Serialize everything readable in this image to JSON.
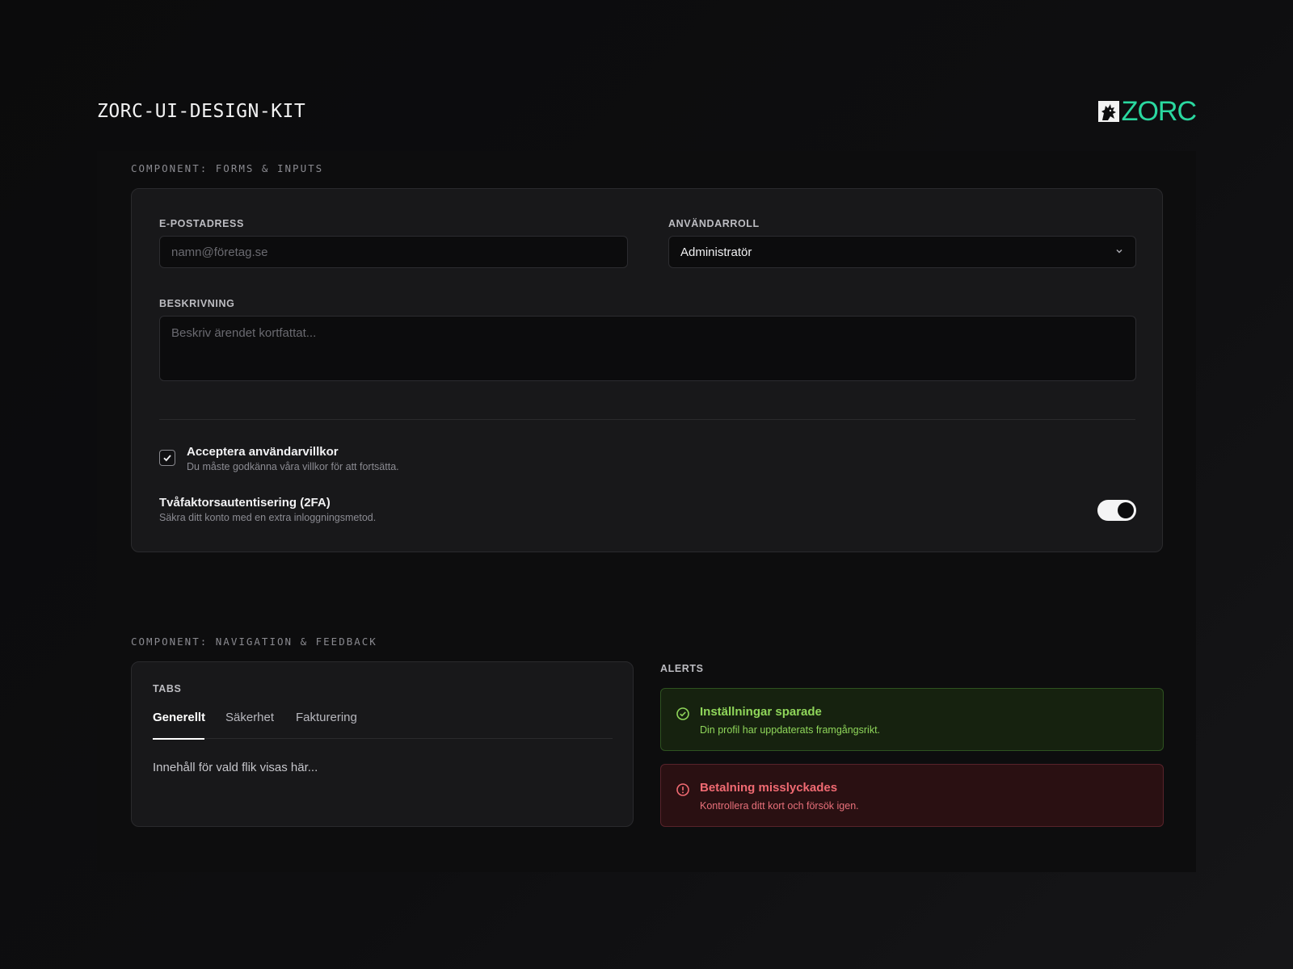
{
  "header": {
    "kit_title": "ZORC-UI-DESIGN-KIT",
    "logo_text": "ZORC",
    "logo_color": "#2ad8a0"
  },
  "forms_section": {
    "label": "COMPONENT: FORMS & INPUTS",
    "email": {
      "label": "E-POSTADRESS",
      "value": "",
      "placeholder": "namn@företag.se"
    },
    "role": {
      "label": "ANVÄNDARROLL",
      "selected": "Administratör",
      "icon": "chevron-down-icon"
    },
    "description": {
      "label": "BESKRIVNING",
      "value": "",
      "placeholder": "Beskriv ärendet kortfattat..."
    },
    "terms": {
      "checked": true,
      "title": "Acceptera användarvillkor",
      "subtitle": "Du måste godkänna våra villkor för att fortsätta."
    },
    "two_factor": {
      "enabled": true,
      "title": "Tvåfaktorsautentisering (2FA)",
      "subtitle": "Säkra ditt konto med en extra inloggningsmetod."
    }
  },
  "nav_section": {
    "label": "COMPONENT: NAVIGATION & FEEDBACK",
    "tabs": {
      "label": "TABS",
      "items": [
        {
          "label": "Generellt",
          "active": true
        },
        {
          "label": "Säkerhet",
          "active": false
        },
        {
          "label": "Fakturering",
          "active": false
        }
      ],
      "content": "Innehåll för vald flik visas här..."
    },
    "alerts": {
      "label": "ALERTS",
      "success": {
        "title": "Inställningar sparade",
        "message": "Din profil har uppdaterats framgångsrikt.",
        "color": "#8fd65a",
        "icon": "check-circle-icon"
      },
      "error": {
        "title": "Betalning misslyckades",
        "message": "Kontrollera ditt kort och försök igen.",
        "color": "#f06a72",
        "icon": "alert-circle-icon"
      }
    }
  }
}
